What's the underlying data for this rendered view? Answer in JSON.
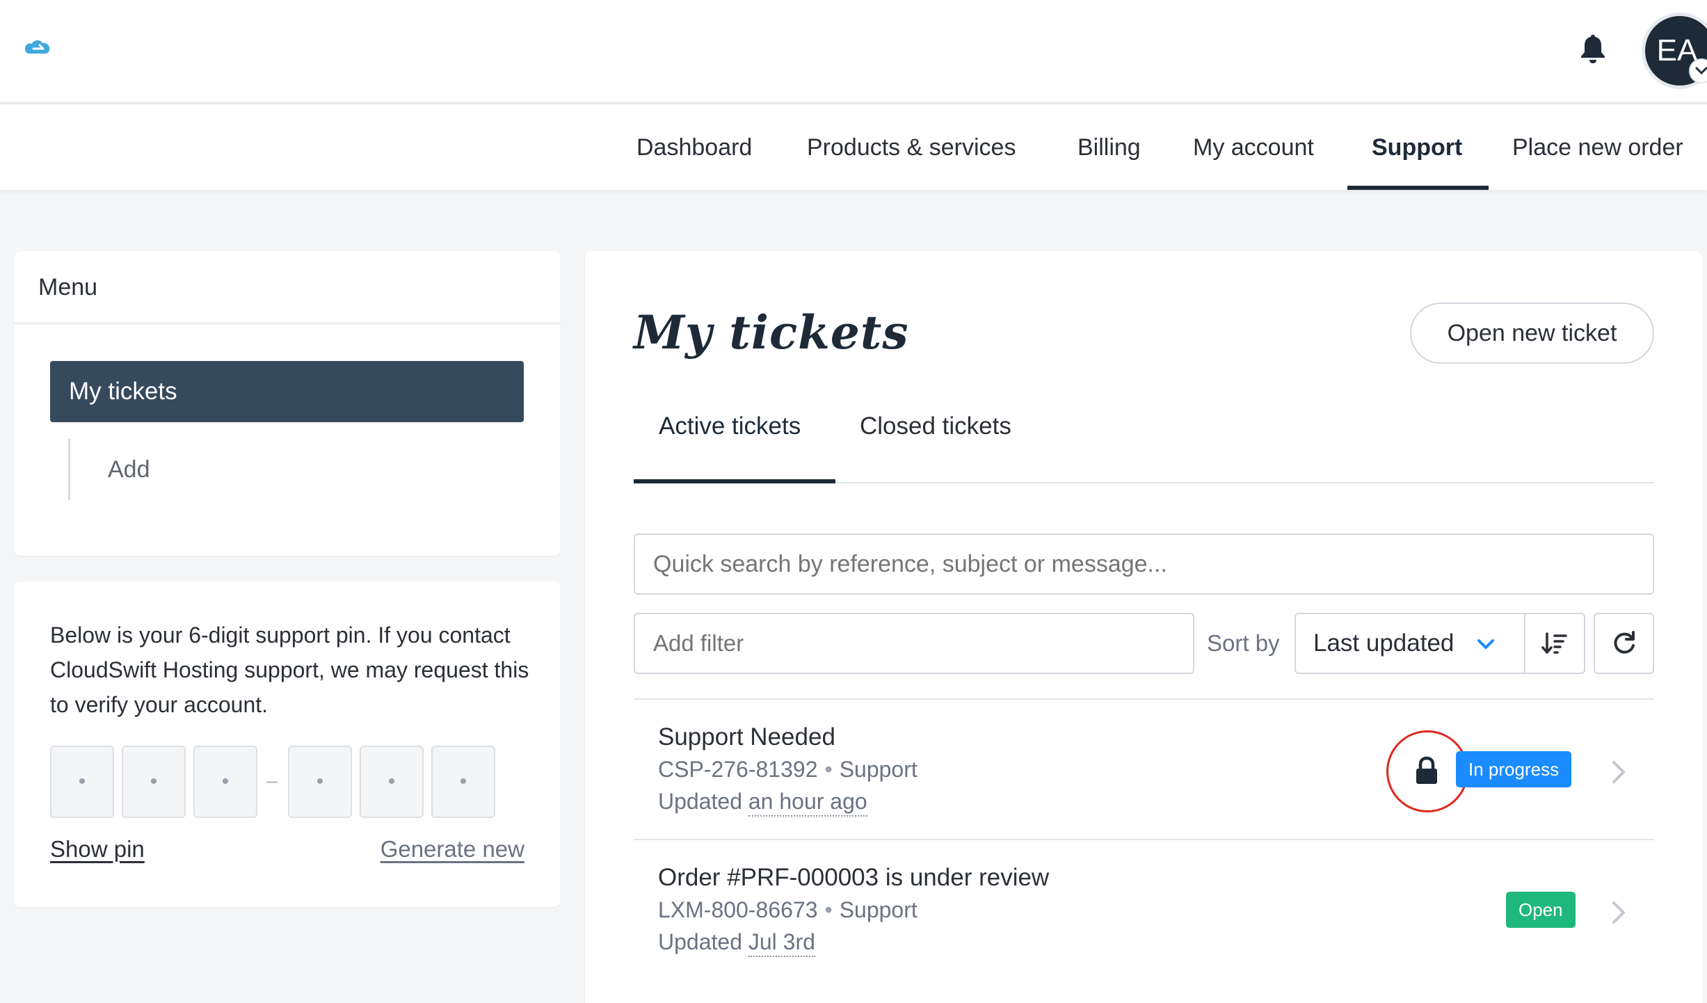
{
  "header": {
    "logo_icon": "cloud-logo-icon",
    "bell_icon": "bell-icon",
    "avatar_initials": "EA"
  },
  "nav": {
    "items": [
      {
        "label": "Dashboard"
      },
      {
        "label": "Products & services"
      },
      {
        "label": "Billing"
      },
      {
        "label": "My account"
      },
      {
        "label": "Support",
        "active": true
      },
      {
        "label": "Place new order"
      }
    ]
  },
  "sidebar": {
    "menu_title": "Menu",
    "active_item": "My tickets",
    "sub_item": "Add"
  },
  "pin_card": {
    "text": "Below is your 6-digit support pin. If you contact CloudSwift Hosting support, we may request this to verify your account.",
    "digits": [
      "•",
      "•",
      "•",
      "•",
      "•",
      "•"
    ],
    "show_pin": "Show pin",
    "generate_new": "Generate new"
  },
  "main": {
    "title": "My tickets",
    "open_new_ticket": "Open new ticket",
    "tabs": [
      {
        "label": "Active tickets",
        "active": true
      },
      {
        "label": "Closed tickets"
      }
    ],
    "search_placeholder": "Quick search by reference, subject or message...",
    "filter_placeholder": "Add filter",
    "sort_by_label": "Sort by",
    "sort_value": "Last updated",
    "tickets": [
      {
        "subject": "Support Needed",
        "reference": "CSP-276-81392",
        "department": "Support",
        "updated_prefix": "Updated",
        "updated": "an hour ago",
        "status": "In progress",
        "status_color": "#1a8cff",
        "locked": true
      },
      {
        "subject": "Order #PRF-000003 is under review",
        "reference": "LXM-800-86673",
        "department": "Support",
        "updated_prefix": "Updated",
        "updated": "Jul 3rd",
        "status": "Open",
        "status_color": "#1fb87c",
        "locked": false
      }
    ]
  },
  "colors": {
    "primary_dark": "#1e2a38",
    "menu_active_bg": "#364a5e",
    "logo": "#3fa9e0",
    "highlight": "#e0281e"
  }
}
